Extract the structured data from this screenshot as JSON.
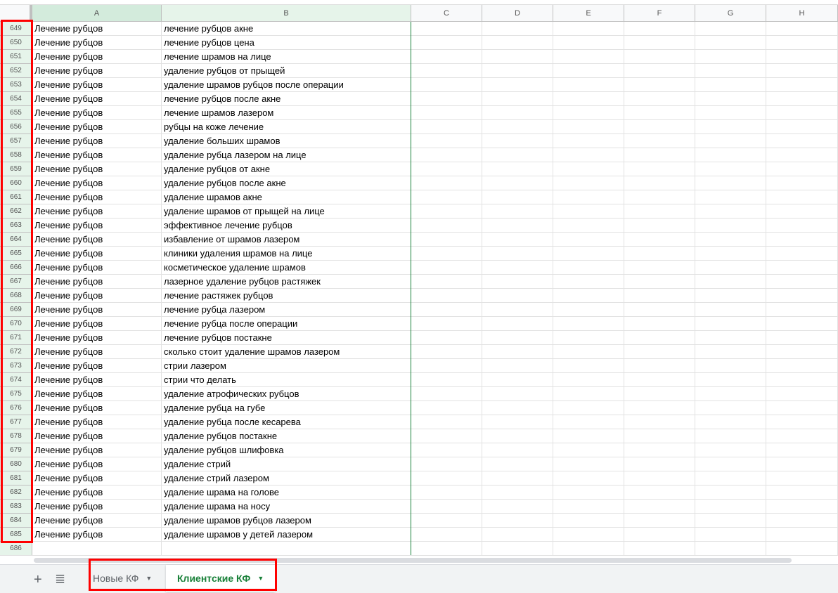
{
  "columns": [
    "A",
    "B",
    "C",
    "D",
    "E",
    "F",
    "G",
    "H"
  ],
  "rows": [
    {
      "n": "649",
      "a": "Лечение рубцов",
      "b": "лечение рубцов акне"
    },
    {
      "n": "650",
      "a": "Лечение рубцов",
      "b": "лечение рубцов цена"
    },
    {
      "n": "651",
      "a": "Лечение рубцов",
      "b": "лечение шрамов на лице"
    },
    {
      "n": "652",
      "a": "Лечение рубцов",
      "b": "удаление рубцов от прыщей"
    },
    {
      "n": "653",
      "a": "Лечение рубцов",
      "b": "удаление шрамов рубцов после операции"
    },
    {
      "n": "654",
      "a": "Лечение рубцов",
      "b": "лечение рубцов после акне"
    },
    {
      "n": "655",
      "a": "Лечение рубцов",
      "b": "лечение шрамов лазером"
    },
    {
      "n": "656",
      "a": "Лечение рубцов",
      "b": "рубцы на коже лечение"
    },
    {
      "n": "657",
      "a": "Лечение рубцов",
      "b": "удаление больших шрамов"
    },
    {
      "n": "658",
      "a": "Лечение рубцов",
      "b": "удаление рубца лазером на лице"
    },
    {
      "n": "659",
      "a": "Лечение рубцов",
      "b": "удаление рубцов от акне"
    },
    {
      "n": "660",
      "a": "Лечение рубцов",
      "b": "удаление рубцов после акне"
    },
    {
      "n": "661",
      "a": "Лечение рубцов",
      "b": "удаление шрамов акне"
    },
    {
      "n": "662",
      "a": "Лечение рубцов",
      "b": "удаление шрамов от прыщей на лице"
    },
    {
      "n": "663",
      "a": "Лечение рубцов",
      "b": "эффективное лечение рубцов"
    },
    {
      "n": "664",
      "a": "Лечение рубцов",
      "b": "избавление от шрамов лазером"
    },
    {
      "n": "665",
      "a": "Лечение рубцов",
      "b": "клиники удаления шрамов на лице"
    },
    {
      "n": "666",
      "a": "Лечение рубцов",
      "b": "косметическое удаление шрамов"
    },
    {
      "n": "667",
      "a": "Лечение рубцов",
      "b": "лазерное удаление рубцов растяжек"
    },
    {
      "n": "668",
      "a": "Лечение рубцов",
      "b": "лечение растяжек рубцов"
    },
    {
      "n": "669",
      "a": "Лечение рубцов",
      "b": "лечение рубца лазером"
    },
    {
      "n": "670",
      "a": "Лечение рубцов",
      "b": "лечение рубца после операции"
    },
    {
      "n": "671",
      "a": "Лечение рубцов",
      "b": "лечение рубцов постакне"
    },
    {
      "n": "672",
      "a": "Лечение рубцов",
      "b": "сколько стоит удаление шрамов лазером"
    },
    {
      "n": "673",
      "a": "Лечение рубцов",
      "b": "стрии лазером"
    },
    {
      "n": "674",
      "a": "Лечение рубцов",
      "b": "стрии что делать"
    },
    {
      "n": "675",
      "a": "Лечение рубцов",
      "b": "удаление атрофических рубцов"
    },
    {
      "n": "676",
      "a": "Лечение рубцов",
      "b": "удаление рубца на губе"
    },
    {
      "n": "677",
      "a": "Лечение рубцов",
      "b": "удаление рубца после кесарева"
    },
    {
      "n": "678",
      "a": "Лечение рубцов",
      "b": "удаление рубцов постакне"
    },
    {
      "n": "679",
      "a": "Лечение рубцов",
      "b": "удаление рубцов шлифовка"
    },
    {
      "n": "680",
      "a": "Лечение рубцов",
      "b": "удаление стрий"
    },
    {
      "n": "681",
      "a": "Лечение рубцов",
      "b": "удаление стрий лазером"
    },
    {
      "n": "682",
      "a": "Лечение рубцов",
      "b": "удаление шрама на голове"
    },
    {
      "n": "683",
      "a": "Лечение рубцов",
      "b": "удаление шрама на носу"
    },
    {
      "n": "684",
      "a": "Лечение рубцов",
      "b": "удаление шрамов рубцов лазером"
    },
    {
      "n": "685",
      "a": "Лечение рубцов",
      "b": "удаление шрамов у детей лазером"
    },
    {
      "n": "686",
      "a": "",
      "b": ""
    }
  ],
  "sheet_tabs": {
    "add": "+",
    "menu": "≣",
    "tabs": [
      {
        "label": "Новые КФ",
        "active": false
      },
      {
        "label": "Клиентские КФ",
        "active": true
      }
    ],
    "caret": "▼"
  },
  "colors": {
    "accent": "#188038",
    "annotation": "#ff0000"
  }
}
